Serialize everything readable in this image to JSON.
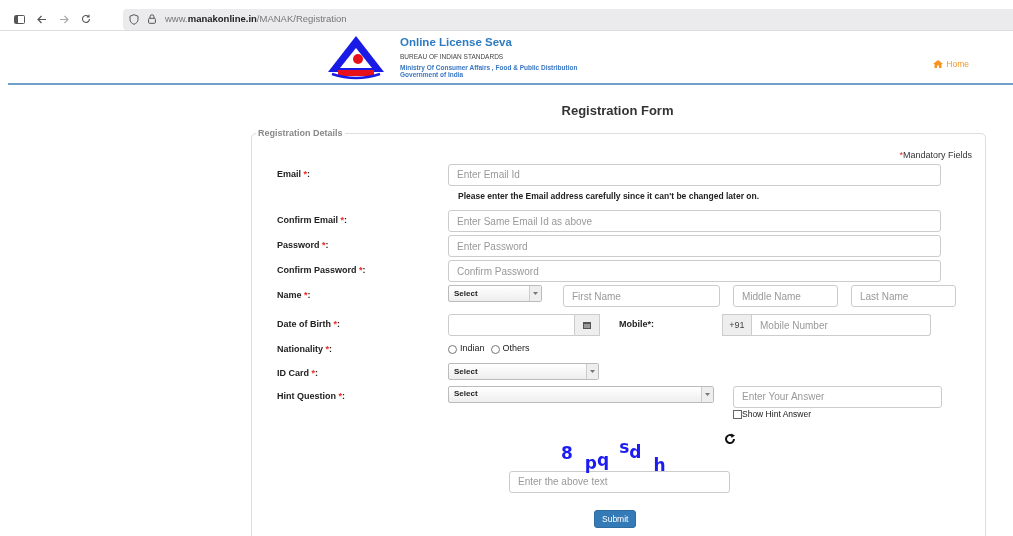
{
  "browser": {
    "url": "www.**manakonline.in**/MANAK/Registration"
  },
  "header": {
    "title": "Online License Seva",
    "org": "BUREAU OF INDIAN STANDARDS",
    "ministry": "Ministry Of Consumer Affairs , Food & Public Distribution",
    "government": "Government of India",
    "home_link": "Home"
  },
  "page_title": "Registration Form",
  "legend": "Registration Details",
  "mandatory_note": {
    "mark": "*",
    "text": "Mandatory Fields"
  },
  "rows": [
    {
      "kind": "text",
      "label": "Email",
      "mark": "*",
      "colon": ":",
      "placeholder": "Enter Email Id",
      "note": "Please enter the Email address carefully since it can't be changed later on."
    },
    {
      "kind": "text",
      "label": "Confirm Email",
      "mark": "*",
      "colon": ":",
      "placeholder": "Enter Same Email Id as above"
    },
    {
      "kind": "text",
      "label": "Password",
      "mark": "*",
      "colon": ":",
      "placeholder": "Enter Password"
    },
    {
      "kind": "text",
      "label": "Confirm Password",
      "mark": "*",
      "colon": ":",
      "placeholder": "Confirm Password"
    },
    {
      "kind": "name",
      "label": "Name",
      "mark": "*",
      "colon": ":",
      "select": "Select",
      "placeholders": [
        "First Name",
        "Middle Name",
        "Last Name"
      ]
    },
    {
      "kind": "dob",
      "label": "Date of Birth",
      "mark": "*",
      "colon": ":",
      "mobile_label": "Mobile*:",
      "prefix": "+91",
      "mobile_placeholder": "Mobile Number"
    },
    {
      "kind": "radio",
      "label": "Nationality",
      "mark": "*",
      "colon": ":",
      "options": [
        {
          "label": "Indian",
          "selected": false
        },
        {
          "label": "Others",
          "selected": false
        }
      ]
    },
    {
      "kind": "select",
      "label": "ID Card",
      "mark": "*",
      "colon": ":",
      "select": "Select"
    },
    {
      "kind": "hint",
      "label": "Hint Question",
      "mark": "*",
      "colon": ":",
      "select": "Select",
      "placeholder": "Enter Your Answer",
      "checkbox": {
        "label": "Show Hint Answer",
        "checked": false
      }
    }
  ],
  "captcha": {
    "chars": [
      "8",
      "p",
      "q",
      "s",
      "d",
      "h"
    ],
    "placeholder": "Enter the above text"
  },
  "submit": "Submit"
}
